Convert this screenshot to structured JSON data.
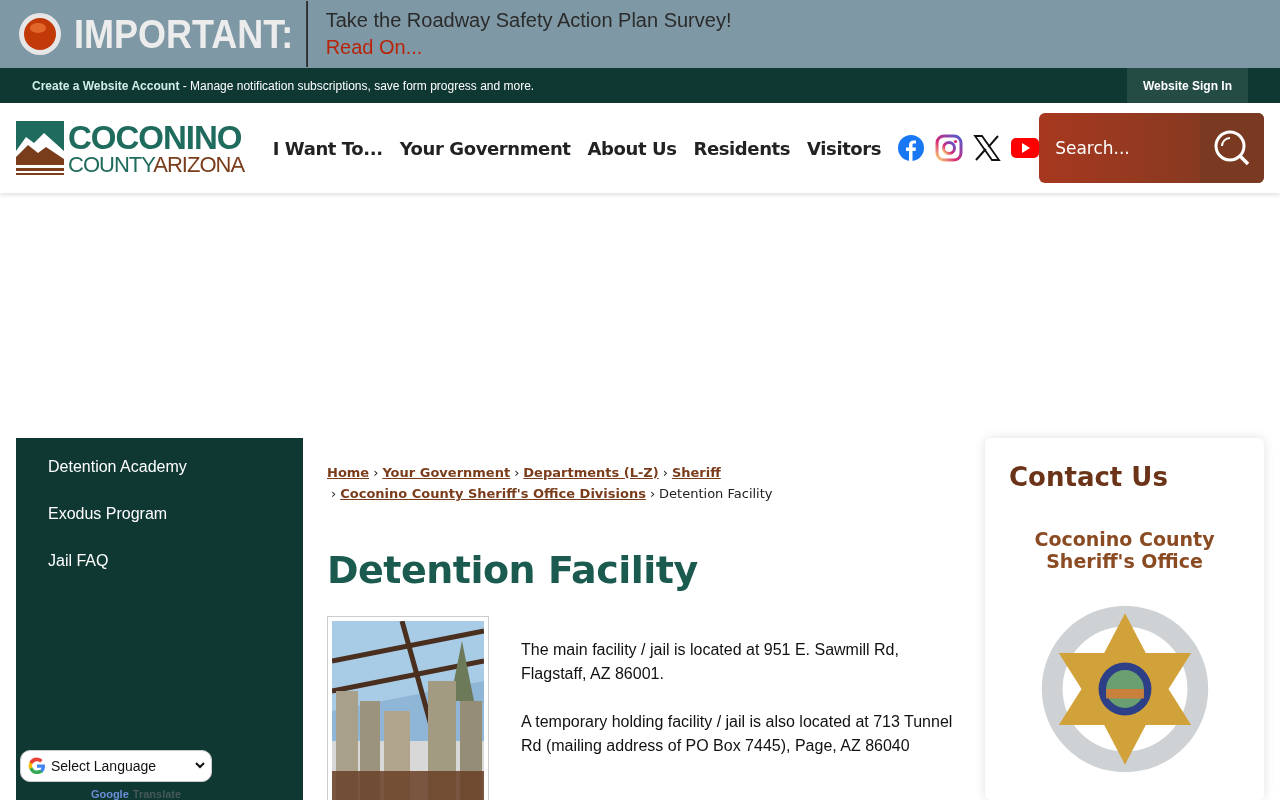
{
  "alert": {
    "label": "IMPORTANT:",
    "message": "Take the Roadway Safety Action Plan Survey!",
    "link": "Read On..."
  },
  "account_bar": {
    "link": "Create a Website Account",
    "text": " - Manage notification subscriptions, save form progress and more.",
    "sign_in": "Website Sign In"
  },
  "header": {
    "logo": {
      "line1": "COCONINO",
      "line2a": "COUNTY",
      "line2b": "ARIZONA"
    },
    "nav": [
      "I Want To...",
      "Your Government",
      "About Us",
      "Residents",
      "Visitors"
    ],
    "social": [
      {
        "kind": "facebook"
      },
      {
        "kind": "instagram"
      },
      {
        "kind": "x"
      },
      {
        "kind": "youtube"
      }
    ],
    "search": {
      "placeholder": "Search..."
    }
  },
  "sidebar": {
    "items": [
      "Detention Academy",
      "Exodus Program",
      "Jail FAQ"
    ]
  },
  "breadcrumb": {
    "separator": "›",
    "links": [
      "Home",
      "Your Government",
      "Departments (L-Z)",
      "Sheriff",
      "Coconino County Sheriff's Office Divisions"
    ],
    "current": "Detention Facility"
  },
  "page_title": "Detention Facility",
  "photo": {
    "kind": "picture"
  },
  "paragraphs": [
    "The main facility / jail is located at 951 E. Sawmill Rd, Flagstaff, AZ 86001.",
    "A temporary holding facility / jail is also located at 713 Tunnel Rd (mailing address of PO Box 7445), Page, AZ 86040"
  ],
  "contact": {
    "title": "Contact Us",
    "office": "Coconino County Sheriff's Office",
    "badge": {
      "kind": "picture"
    }
  },
  "translate": {
    "select": "Select Language",
    "brand": "Google",
    "label": "Translate"
  }
}
